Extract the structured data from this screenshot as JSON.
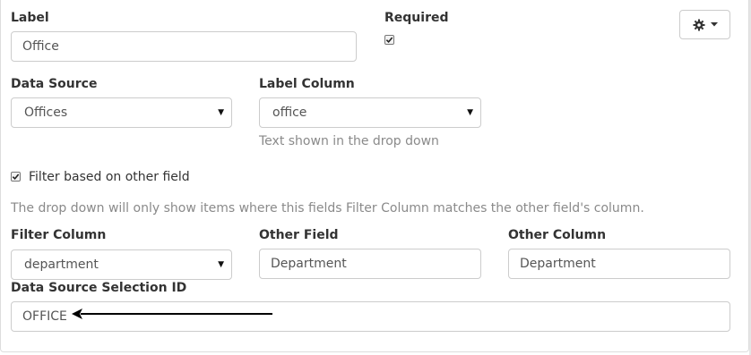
{
  "fields": {
    "label": {
      "title": "Label",
      "value": "Office"
    },
    "required": {
      "title": "Required",
      "checked": true
    },
    "data_source": {
      "title": "Data Source",
      "value": "Offices"
    },
    "label_column": {
      "title": "Label Column",
      "value": "office",
      "help": "Text shown in the drop down"
    },
    "filter_toggle": {
      "label": "Filter based on other field",
      "checked": true,
      "help": "The drop down will only show items where this fields Filter Column matches the other field's column."
    },
    "filter_column": {
      "title": "Filter Column",
      "value": "department"
    },
    "other_field": {
      "title": "Other Field",
      "value": "Department"
    },
    "other_column": {
      "title": "Other Column",
      "value": "Department"
    },
    "selection_id": {
      "title": "Data Source Selection ID",
      "value": "OFFICE"
    }
  },
  "icons": {
    "settings": "gear-icon",
    "dropdown": "caret-down-icon",
    "annotation": "arrow-left-icon"
  },
  "colors": {
    "border": "#cccccc",
    "label": "#333333",
    "help_text": "#8a8a8a",
    "input_text": "#555555"
  }
}
